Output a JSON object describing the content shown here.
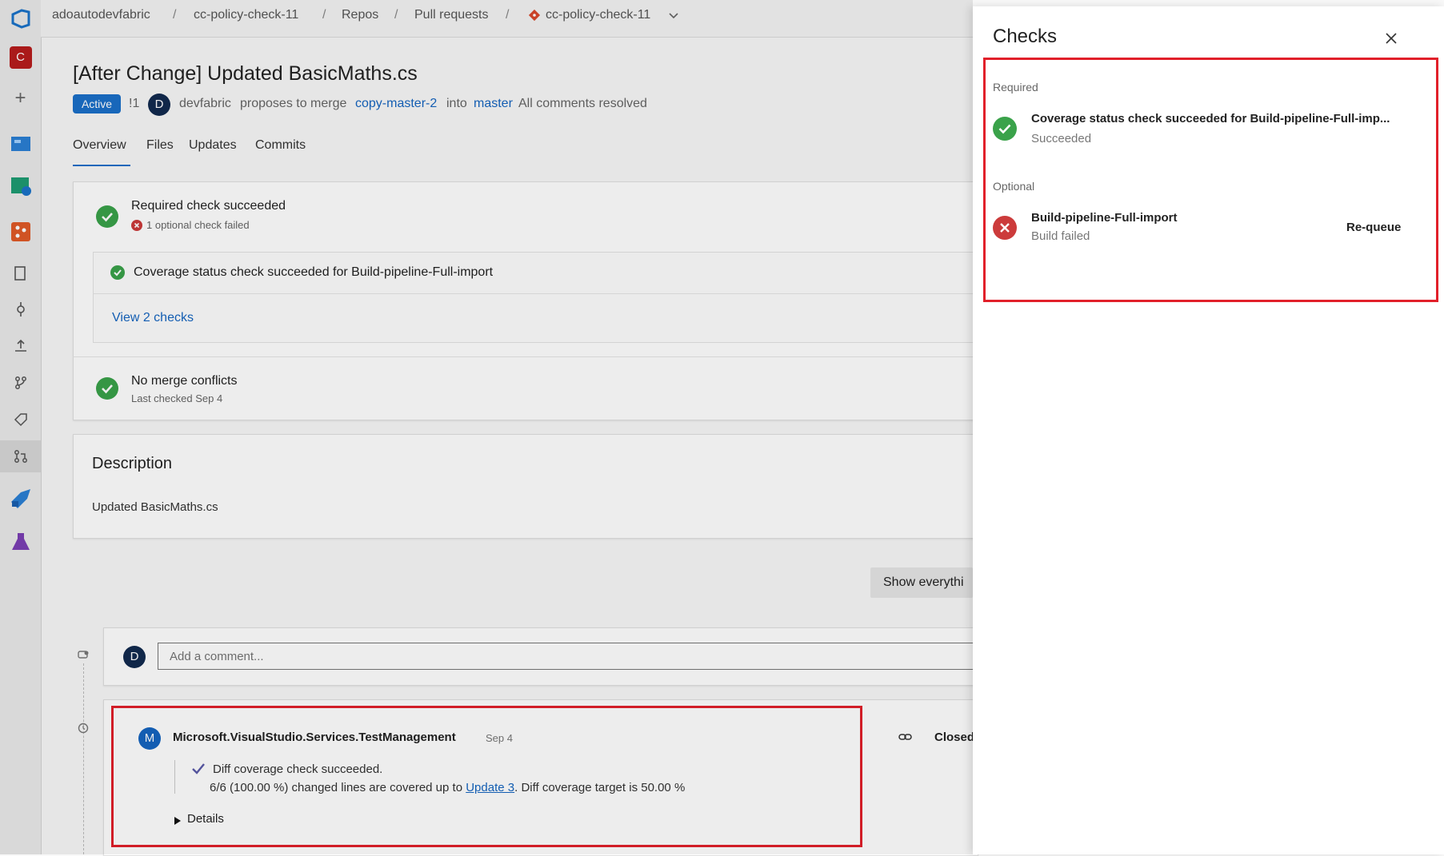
{
  "breadcrumb": {
    "org": "adoautodevfabric",
    "project": "cc-policy-check-11",
    "repos": "Repos",
    "pull_requests": "Pull requests",
    "repo": "cc-policy-check-11",
    "separator": "/"
  },
  "rail": {
    "org_initial": "C"
  },
  "pr": {
    "title": "[After Change] Updated BasicMaths.cs",
    "status": "Active",
    "id": "!1",
    "author_initial": "D",
    "author": "devfabric",
    "proposes_text": "proposes to merge",
    "source_branch": "copy-master-2",
    "into_text": "into",
    "target_branch": "master",
    "comments_status": "All comments resolved"
  },
  "tabs": [
    "Overview",
    "Files",
    "Updates",
    "Commits"
  ],
  "status_card": {
    "required_title": "Required check succeeded",
    "optional_failed": "1 optional check failed",
    "coverage_check": "Coverage status check succeeded for Build-pipeline-Full-import",
    "view_checks": "View 2 checks",
    "merge_title": "No merge conflicts",
    "merge_sub": "Last checked Sep 4"
  },
  "description": {
    "heading": "Description",
    "body": "Updated BasicMaths.cs"
  },
  "show_everything": "Show everythi",
  "comment_box": {
    "avatar_initial": "D",
    "placeholder": "Add a comment..."
  },
  "thread": {
    "avatar_initial": "M",
    "author": "Microsoft.VisualStudio.Services.TestManagement",
    "date": "Sep 4",
    "line1": "Diff coverage check succeeded.",
    "line2_prefix": "6/6 (100.00 %) changed lines are covered up to",
    "line2_link": "Update 3",
    "line2_suffix": ". Diff coverage target is 50.00 %",
    "details": "Details",
    "status": "Closed"
  },
  "checks_panel": {
    "title": "Checks",
    "required_label": "Required",
    "required_item": {
      "name": "Coverage status check succeeded for Build-pipeline-Full-imp...",
      "status": "Succeeded"
    },
    "optional_label": "Optional",
    "optional_item": {
      "name": "Build-pipeline-Full-import",
      "status": "Build failed",
      "action": "Re-queue"
    }
  },
  "colors": {
    "accent": "#1a6fc9",
    "success": "#3aa24a",
    "failure": "#cc3b3b",
    "highlight": "#e1202a"
  }
}
